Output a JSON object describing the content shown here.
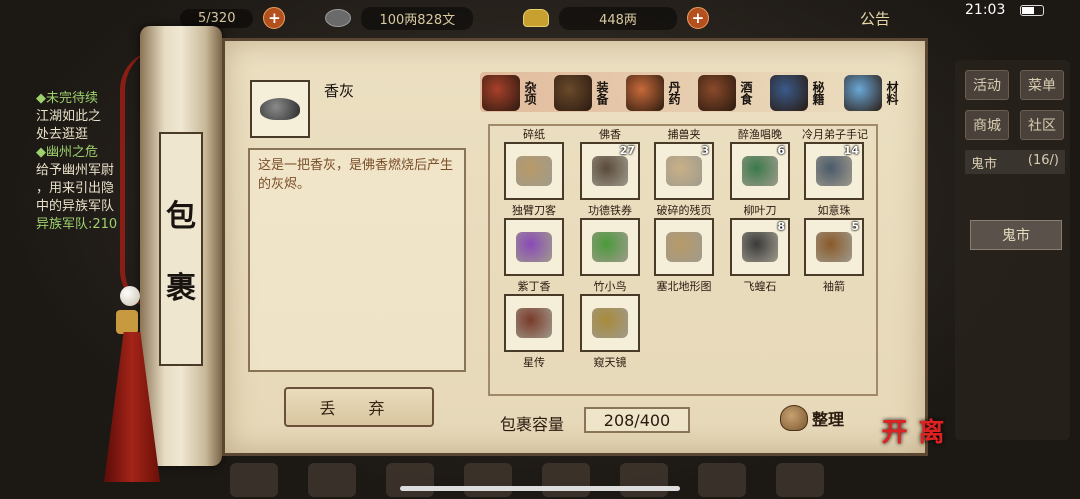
{
  "status": {
    "clock": "21:03",
    "capacity_hint": "5/320",
    "coins": "100两828文",
    "gold": "448两",
    "notice": "公告"
  },
  "quest": {
    "title1": "◆未完待续",
    "line1": "江湖如此之",
    "line2": "处去逛逛",
    "title2": "◆幽州之危",
    "line3": "给予幽州军尉",
    "line4": "，用来引出隐",
    "line5": "中的异族军队",
    "line6": "异族军队:210"
  },
  "side": {
    "activity": "活动",
    "menu": "菜单",
    "shop": "商城",
    "community": "社区",
    "market": "鬼市",
    "market_count": "(16/)",
    "selected": "鬼市"
  },
  "scroll_title": [
    "包",
    "裹"
  ],
  "selected_item": {
    "name": "香灰",
    "description": "这是一把香灰，是佛香燃烧后产生的灰烬。"
  },
  "discard_label": "丢 弃",
  "tabs": [
    {
      "label": "杂项",
      "icon": "misc-jar-icon",
      "color": "#a8402a"
    },
    {
      "label": "装备",
      "icon": "equipment-icon",
      "color": "#6a4a2a"
    },
    {
      "label": "丹药",
      "icon": "pill-icon",
      "color": "#c86a3a"
    },
    {
      "label": "酒食",
      "icon": "wine-food-icon",
      "color": "#8a4a2a"
    },
    {
      "label": "秘籍",
      "icon": "manual-icon",
      "color": "#3a5a8a"
    },
    {
      "label": "材料",
      "icon": "material-crystal-icon",
      "color": "#6aa8d8"
    }
  ],
  "items": [
    {
      "name": "碎纸",
      "count": "",
      "icon": "torn-paper-icon",
      "color": "#b89a68"
    },
    {
      "name": "佛香",
      "count": "",
      "icon": "incense-icon",
      "color": "#8a6a3a"
    },
    {
      "name": "捕兽夹",
      "count": "",
      "icon": "trap-icon",
      "color": "#7a7a7a"
    },
    {
      "name": "醉渔唱晚",
      "count": "",
      "icon": "book-icon",
      "color": "#a88a58"
    },
    {
      "name": "冷月弟子手记",
      "count": "",
      "icon": "notebook-icon",
      "color": "#5a7a9a"
    },
    {
      "name": "独臂刀客",
      "count": "",
      "icon": "open-book-icon",
      "color": "#b89a68"
    },
    {
      "name": "功德铁券",
      "count": "27",
      "icon": "iron-tablet-icon",
      "color": "#5a4a3a"
    },
    {
      "name": "破碎的残页",
      "count": "3",
      "icon": "torn-page-icon",
      "color": "#c8b088"
    },
    {
      "name": "柳叶刀",
      "count": "6",
      "icon": "willow-blade-icon",
      "color": "#3a7a4a"
    },
    {
      "name": "如意珠",
      "count": "14",
      "icon": "beads-icon",
      "color": "#4a5a6a"
    },
    {
      "name": "紫丁香",
      "count": "",
      "icon": "lilac-flower-icon",
      "color": "#8a4ab8"
    },
    {
      "name": "竹小鸟",
      "count": "",
      "icon": "bamboo-bird-icon",
      "color": "#4a9a3a"
    },
    {
      "name": "塞北地形图",
      "count": "",
      "icon": "map-scroll-icon",
      "color": "#b89a68"
    },
    {
      "name": "飞蝗石",
      "count": "8",
      "icon": "stone-icon",
      "color": "#3a3a3a"
    },
    {
      "name": "袖箭",
      "count": "5",
      "icon": "sleeve-arrow-icon",
      "color": "#8a5a2a"
    },
    {
      "name": "星传",
      "count": "",
      "icon": "star-book-icon",
      "color": "#7a3a2a"
    },
    {
      "name": "窥天镜",
      "count": "",
      "icon": "telescope-icon",
      "color": "#a88a3a"
    }
  ],
  "capacity": {
    "label": "包裹容量",
    "value": "208/400"
  },
  "sort_label": "整理",
  "leave_label": "离开"
}
